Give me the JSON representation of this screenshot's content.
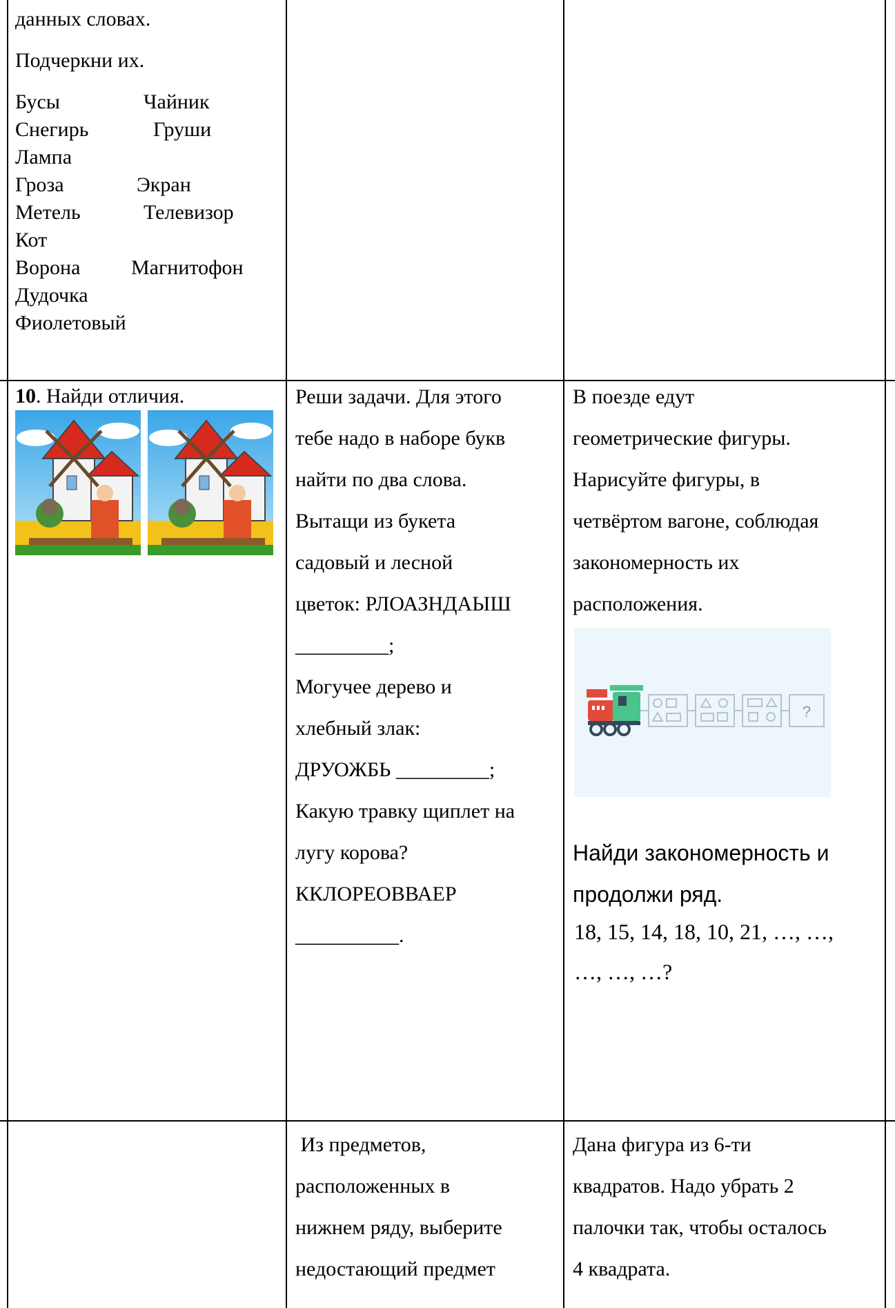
{
  "col1_top": {
    "line1": "данных словах.",
    "line2": "Подчеркни их.",
    "words": [
      [
        "Бусы",
        "Чайник"
      ],
      [
        "Снегирь",
        "Груши"
      ],
      [
        "Лампа",
        ""
      ],
      [
        "Гроза",
        "Экран"
      ],
      [
        "Метель",
        "Телевизор"
      ],
      [
        "Кот",
        ""
      ],
      [
        "Ворона",
        "Магнитофон"
      ],
      [
        "Дудочка",
        ""
      ],
      [
        "Фиолетовый",
        ""
      ]
    ]
  },
  "task10": {
    "number": "10",
    "text": ". Найди отличия."
  },
  "col2_mid": {
    "lines": [
      "Реши задачи. Для этого",
      "тебе надо в наборе букв",
      "найти по два слова.",
      "Вытащи из букета",
      "садовый и лесной",
      "цветок: РЛОАЗНДАЫШ",
      "_________;",
      "Могучее дерево и",
      "хлебный злак:",
      "ДРУОЖБЬ _________;",
      "Какую травку щиплет на",
      "лугу корова?",
      "ККЛОРЕОВВАЕР",
      "__________."
    ]
  },
  "col3_mid": {
    "lines": [
      "В поезде едут",
      "геометрические фигуры.",
      "Нарисуйте фигуры, в",
      "четвёртом вагоне, соблюдая",
      "закономерность их",
      "расположения."
    ],
    "train_question": "?",
    "pattern_title_1": "Найди закономерность и",
    "pattern_title_2": "продолжи ряд.",
    "sequence_1": "18, 15, 14, 18, 10, 21, …, …,",
    "sequence_2": "…, …, …?"
  },
  "col2_bottom": {
    "lines": [
      " Из предметов,",
      "расположенных в",
      "нижнем ряду, выберите",
      "недостающий предмет"
    ]
  },
  "col3_bottom": {
    "lines": [
      "Дана фигура из 6-ти",
      "квадратов. Надо убрать 2",
      "палочки так, чтобы осталось",
      "4 квадрата."
    ]
  }
}
